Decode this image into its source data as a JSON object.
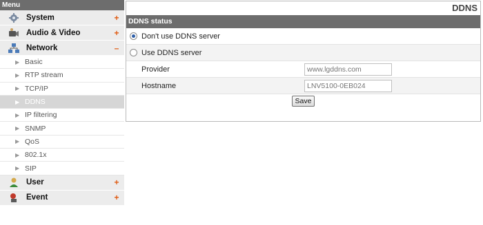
{
  "sidebar": {
    "header": "Menu",
    "categories": {
      "system": {
        "label": "System",
        "toggle": "+",
        "icon": "gear-icon"
      },
      "audio_video": {
        "label": "Audio & Video",
        "toggle": "+",
        "icon": "camera-icon"
      },
      "network": {
        "label": "Network",
        "toggle": "–",
        "icon": "network-icon"
      },
      "user": {
        "label": "User",
        "toggle": "+",
        "icon": "user-icon"
      },
      "event": {
        "label": "Event",
        "toggle": "+",
        "icon": "event-icon"
      }
    },
    "network_items": [
      {
        "label": "Basic"
      },
      {
        "label": "RTP stream"
      },
      {
        "label": "TCP/IP"
      },
      {
        "label": "DDNS",
        "active": true
      },
      {
        "label": "IP filtering"
      },
      {
        "label": "SNMP"
      },
      {
        "label": "QoS"
      },
      {
        "label": "802.1x"
      },
      {
        "label": "SIP"
      }
    ]
  },
  "panel": {
    "title": "DDNS",
    "section": "DDNS status",
    "options": {
      "no_ddns": "Don't use DDNS server",
      "use_ddns": "Use DDNS server"
    },
    "selected_option": "no_ddns",
    "provider": {
      "label": "Provider",
      "placeholder": "www.lgddns.com"
    },
    "hostname": {
      "label": "Hostname",
      "placeholder": "LNV5100-0EB024"
    },
    "save_label": "Save"
  },
  "colors": {
    "header_bg": "#6d6d6d",
    "toggle_accent": "#e05a10",
    "category_bg": "#ececec",
    "active_item_bg": "#d6d6d6",
    "radio_dot": "#2f5fa8"
  }
}
